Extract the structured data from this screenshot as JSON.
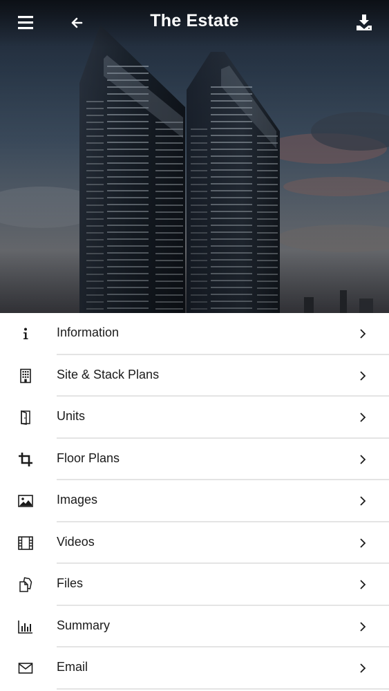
{
  "header": {
    "title": "The Estate"
  },
  "colors": {
    "text": "#1a1a1a",
    "divider": "#e4e4e4",
    "header_text": "#ffffff"
  },
  "menu": {
    "items": [
      {
        "label": "Information",
        "icon": "info-icon"
      },
      {
        "label": "Site & Stack Plans",
        "icon": "building-icon"
      },
      {
        "label": "Units",
        "icon": "door-icon"
      },
      {
        "label": "Floor Plans",
        "icon": "crop-icon"
      },
      {
        "label": "Images",
        "icon": "image-icon"
      },
      {
        "label": "Videos",
        "icon": "film-icon"
      },
      {
        "label": "Files",
        "icon": "files-icon"
      },
      {
        "label": "Summary",
        "icon": "bar-chart-icon"
      },
      {
        "label": "Email",
        "icon": "envelope-icon"
      }
    ]
  }
}
